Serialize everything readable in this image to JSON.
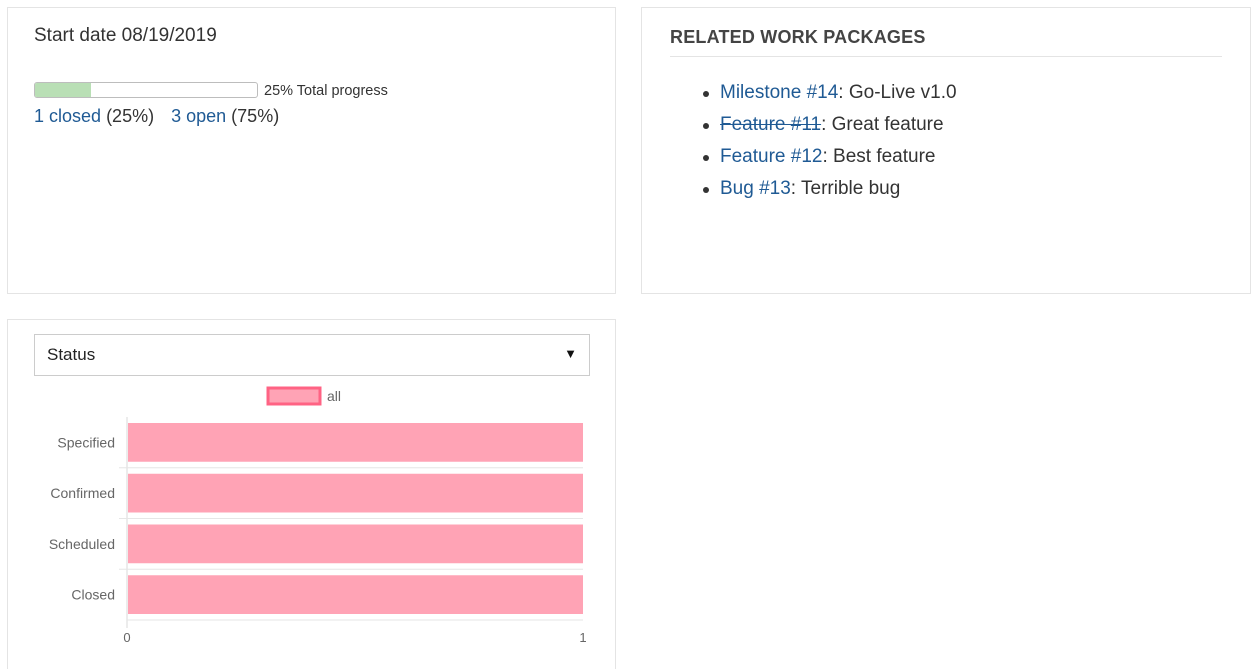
{
  "progress_card": {
    "start_date": "Start date 08/19/2019",
    "progress_fraction": 0.25,
    "progress_label": "25% Total progress",
    "closed_link": "1 closed",
    "closed_pct": "(25%)",
    "open_link": "3 open",
    "open_pct": "(75%)"
  },
  "related_card": {
    "title": "RELATED WORK PACKAGES",
    "items": [
      {
        "link": "Milestone #14",
        "text": ": Go-Live v1.0",
        "struck": false
      },
      {
        "link": "Feature #11",
        "text": ": Great feature",
        "struck": true
      },
      {
        "link": "Feature #12",
        "text": ": Best feature",
        "struck": false
      },
      {
        "link": "Bug #13",
        "text": ": Terrible bug",
        "struck": false
      }
    ]
  },
  "chart_card": {
    "select_value": "Status",
    "select_caret_icon": "triangle-down-icon"
  },
  "colors": {
    "link": "#1f5a94",
    "progress_fill": "#b9dfb5",
    "bar_fill": "#ffa3b5",
    "bar_border": "#ff6384"
  },
  "chart_data": {
    "type": "bar",
    "orientation": "horizontal",
    "categories": [
      "Specified",
      "Confirmed",
      "Scheduled",
      "Closed"
    ],
    "series": [
      {
        "name": "all",
        "values": [
          1,
          1,
          1,
          1
        ]
      }
    ],
    "xlim": [
      0,
      1
    ],
    "xticks": [
      "0",
      "1"
    ],
    "legend": "top",
    "grid": true
  }
}
